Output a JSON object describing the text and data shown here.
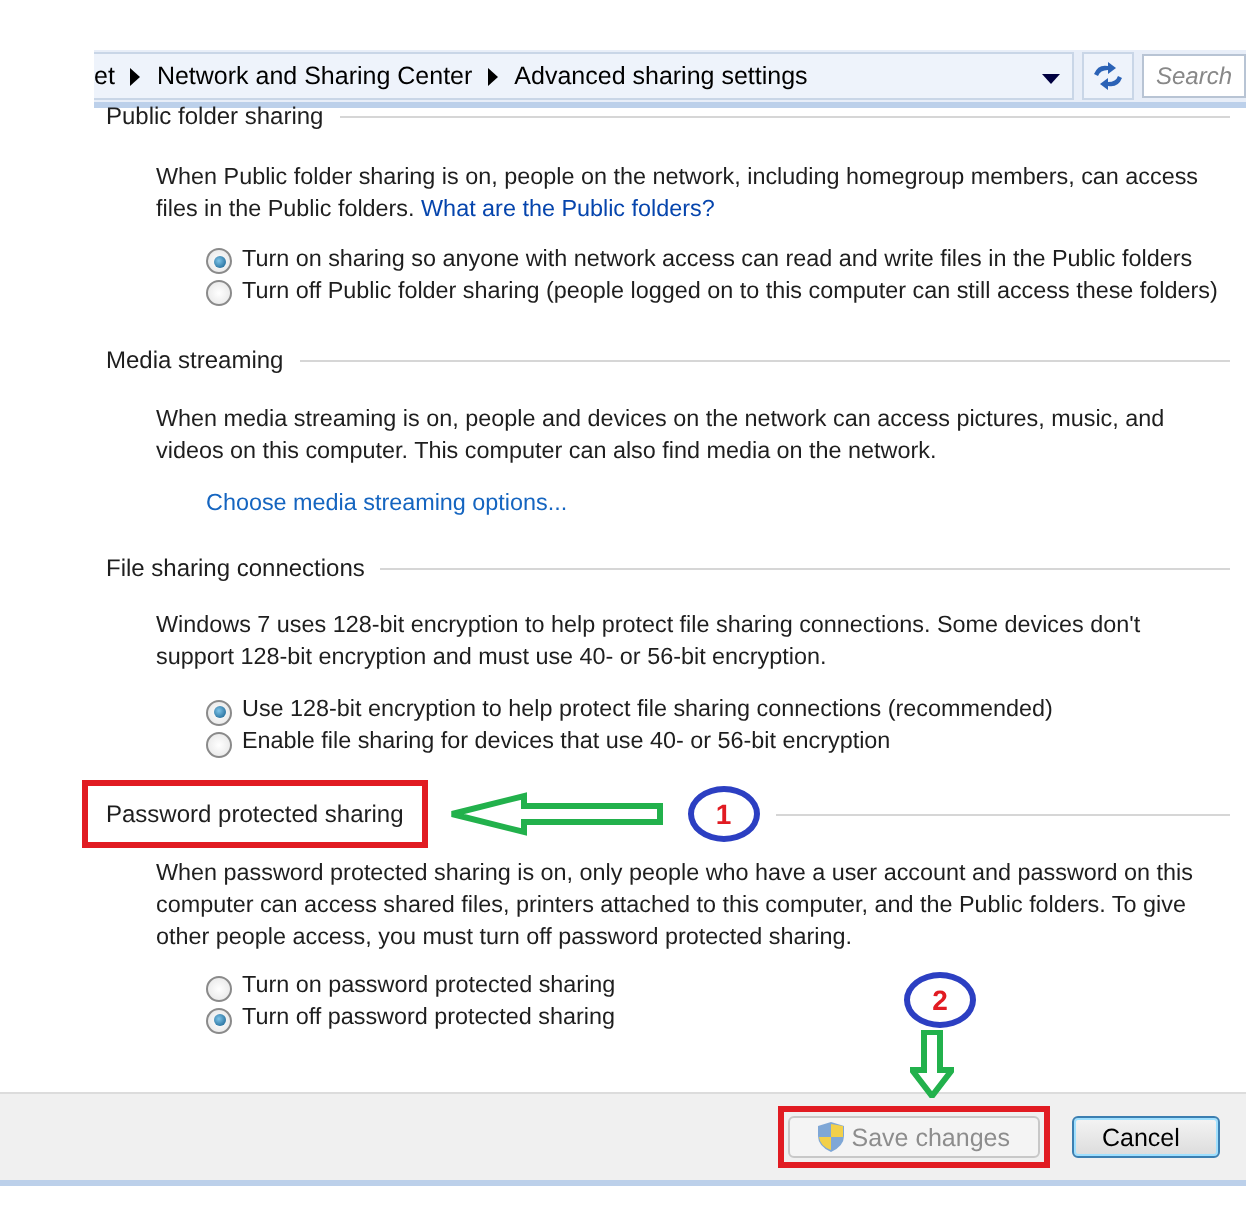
{
  "address_bar": {
    "breadcrumbs": [
      "et",
      "Network and Sharing Center",
      "Advanced sharing settings"
    ],
    "search": {
      "placeholder": "Search"
    }
  },
  "sections": [
    {
      "heading": "Public folder sharing",
      "highlighted": false,
      "description": "When Public folder sharing is on, people on the network, including homegroup members, can access files in the Public folders.",
      "inline_link": "What are the Public folders?",
      "options": [
        {
          "label": "Turn on sharing so anyone with network access can read and write files in the Public folders",
          "selected": true
        },
        {
          "label": "Turn off Public folder sharing (people logged on to this computer can still access these folders)",
          "selected": false
        }
      ]
    },
    {
      "heading": "Media streaming",
      "highlighted": false,
      "description": "When media streaming is on, people and devices on the network can access pictures, music, and videos on this computer. This computer can also find media on the network.",
      "action_link": "Choose media streaming options..."
    },
    {
      "heading": "File sharing connections",
      "highlighted": false,
      "description": "Windows 7 uses 128-bit encryption to help protect file sharing connections. Some devices don't support 128-bit encryption and must use 40- or 56-bit encryption.",
      "options": [
        {
          "label": "Use 128-bit encryption to help protect file sharing connections (recommended)",
          "selected": true
        },
        {
          "label": "Enable file sharing for devices that use 40- or 56-bit encryption",
          "selected": false
        }
      ]
    },
    {
      "heading": "Password protected sharing",
      "highlighted": true,
      "callout": "1",
      "description": "When password protected sharing is on, only people who have a user account and password on this computer can access shared files, printers attached to this computer, and the Public folders. To give other people access, you must turn off password protected sharing.",
      "options": [
        {
          "label": "Turn on password protected sharing",
          "selected": false
        },
        {
          "label": "Turn off password protected sharing",
          "selected": true
        }
      ]
    }
  ],
  "buttons": [
    {
      "label": "Save changes",
      "disabled": true,
      "highlighted": true,
      "callout": "2"
    },
    {
      "label": "Cancel",
      "disabled": false,
      "highlighted": false
    }
  ]
}
